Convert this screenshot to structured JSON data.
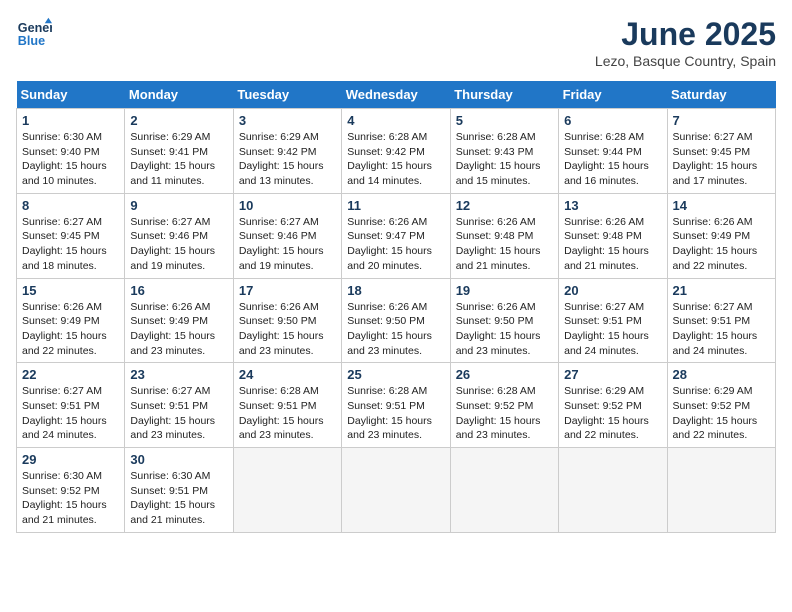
{
  "header": {
    "logo_line1": "General",
    "logo_line2": "Blue",
    "month_title": "June 2025",
    "location": "Lezo, Basque Country, Spain"
  },
  "days_of_week": [
    "Sunday",
    "Monday",
    "Tuesday",
    "Wednesday",
    "Thursday",
    "Friday",
    "Saturday"
  ],
  "weeks": [
    [
      {
        "day": 1,
        "sunrise": "6:30 AM",
        "sunset": "9:40 PM",
        "daylight": "15 hours and 10 minutes."
      },
      {
        "day": 2,
        "sunrise": "6:29 AM",
        "sunset": "9:41 PM",
        "daylight": "15 hours and 11 minutes."
      },
      {
        "day": 3,
        "sunrise": "6:29 AM",
        "sunset": "9:42 PM",
        "daylight": "15 hours and 13 minutes."
      },
      {
        "day": 4,
        "sunrise": "6:28 AM",
        "sunset": "9:42 PM",
        "daylight": "15 hours and 14 minutes."
      },
      {
        "day": 5,
        "sunrise": "6:28 AM",
        "sunset": "9:43 PM",
        "daylight": "15 hours and 15 minutes."
      },
      {
        "day": 6,
        "sunrise": "6:28 AM",
        "sunset": "9:44 PM",
        "daylight": "15 hours and 16 minutes."
      },
      {
        "day": 7,
        "sunrise": "6:27 AM",
        "sunset": "9:45 PM",
        "daylight": "15 hours and 17 minutes."
      }
    ],
    [
      {
        "day": 8,
        "sunrise": "6:27 AM",
        "sunset": "9:45 PM",
        "daylight": "15 hours and 18 minutes."
      },
      {
        "day": 9,
        "sunrise": "6:27 AM",
        "sunset": "9:46 PM",
        "daylight": "15 hours and 19 minutes."
      },
      {
        "day": 10,
        "sunrise": "6:27 AM",
        "sunset": "9:46 PM",
        "daylight": "15 hours and 19 minutes."
      },
      {
        "day": 11,
        "sunrise": "6:26 AM",
        "sunset": "9:47 PM",
        "daylight": "15 hours and 20 minutes."
      },
      {
        "day": 12,
        "sunrise": "6:26 AM",
        "sunset": "9:48 PM",
        "daylight": "15 hours and 21 minutes."
      },
      {
        "day": 13,
        "sunrise": "6:26 AM",
        "sunset": "9:48 PM",
        "daylight": "15 hours and 21 minutes."
      },
      {
        "day": 14,
        "sunrise": "6:26 AM",
        "sunset": "9:49 PM",
        "daylight": "15 hours and 22 minutes."
      }
    ],
    [
      {
        "day": 15,
        "sunrise": "6:26 AM",
        "sunset": "9:49 PM",
        "daylight": "15 hours and 22 minutes."
      },
      {
        "day": 16,
        "sunrise": "6:26 AM",
        "sunset": "9:49 PM",
        "daylight": "15 hours and 23 minutes."
      },
      {
        "day": 17,
        "sunrise": "6:26 AM",
        "sunset": "9:50 PM",
        "daylight": "15 hours and 23 minutes."
      },
      {
        "day": 18,
        "sunrise": "6:26 AM",
        "sunset": "9:50 PM",
        "daylight": "15 hours and 23 minutes."
      },
      {
        "day": 19,
        "sunrise": "6:26 AM",
        "sunset": "9:50 PM",
        "daylight": "15 hours and 23 minutes."
      },
      {
        "day": 20,
        "sunrise": "6:27 AM",
        "sunset": "9:51 PM",
        "daylight": "15 hours and 24 minutes."
      },
      {
        "day": 21,
        "sunrise": "6:27 AM",
        "sunset": "9:51 PM",
        "daylight": "15 hours and 24 minutes."
      }
    ],
    [
      {
        "day": 22,
        "sunrise": "6:27 AM",
        "sunset": "9:51 PM",
        "daylight": "15 hours and 24 minutes."
      },
      {
        "day": 23,
        "sunrise": "6:27 AM",
        "sunset": "9:51 PM",
        "daylight": "15 hours and 23 minutes."
      },
      {
        "day": 24,
        "sunrise": "6:28 AM",
        "sunset": "9:51 PM",
        "daylight": "15 hours and 23 minutes."
      },
      {
        "day": 25,
        "sunrise": "6:28 AM",
        "sunset": "9:51 PM",
        "daylight": "15 hours and 23 minutes."
      },
      {
        "day": 26,
        "sunrise": "6:28 AM",
        "sunset": "9:52 PM",
        "daylight": "15 hours and 23 minutes."
      },
      {
        "day": 27,
        "sunrise": "6:29 AM",
        "sunset": "9:52 PM",
        "daylight": "15 hours and 22 minutes."
      },
      {
        "day": 28,
        "sunrise": "6:29 AM",
        "sunset": "9:52 PM",
        "daylight": "15 hours and 22 minutes."
      }
    ],
    [
      {
        "day": 29,
        "sunrise": "6:30 AM",
        "sunset": "9:52 PM",
        "daylight": "15 hours and 21 minutes."
      },
      {
        "day": 30,
        "sunrise": "6:30 AM",
        "sunset": "9:51 PM",
        "daylight": "15 hours and 21 minutes."
      },
      null,
      null,
      null,
      null,
      null
    ]
  ]
}
